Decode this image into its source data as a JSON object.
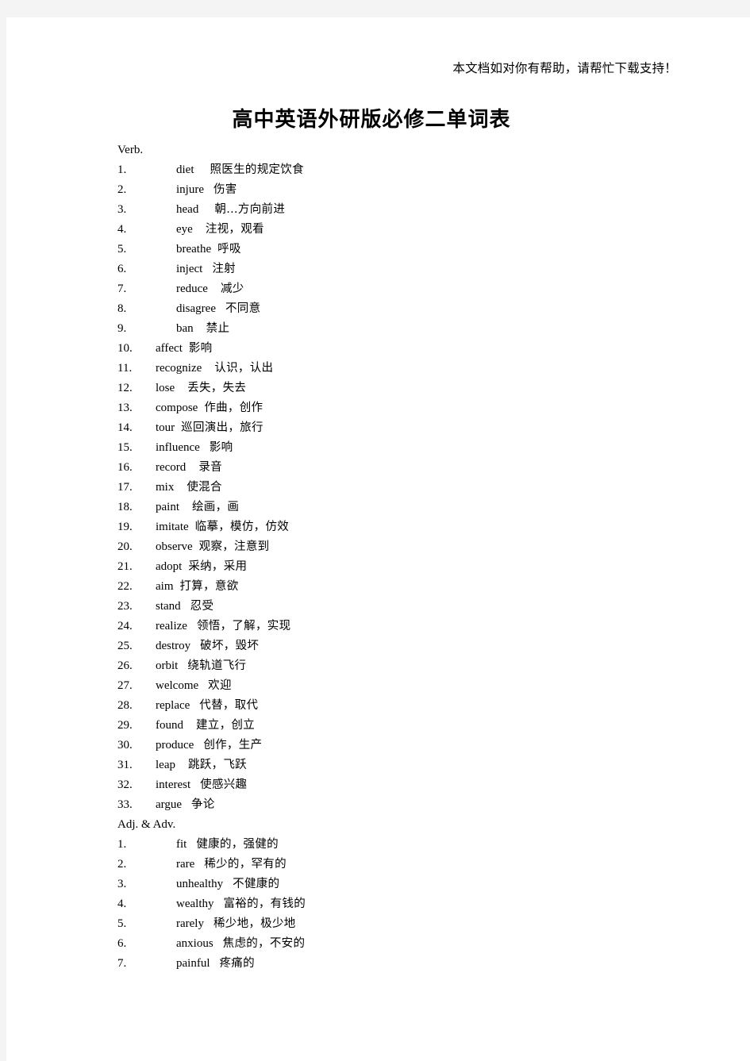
{
  "document": {
    "header_note": "本文档如对你有帮助，请帮忙下载支持！",
    "title": "高中英语外研版必修二单词表"
  },
  "sections": [
    {
      "heading": "Verb.",
      "entries": [
        {
          "num": "1.",
          "word": "diet",
          "meaning": "照医生的规定饮食",
          "gap": 4
        },
        {
          "num": "2.",
          "word": "injure",
          "meaning": "伤害",
          "gap": 2
        },
        {
          "num": "3.",
          "word": "head",
          "meaning": "朝…方向前进",
          "gap": 4
        },
        {
          "num": "4.",
          "word": "eye",
          "meaning": "注视，观看",
          "gap": 3
        },
        {
          "num": "5.",
          "word": "breathe",
          "meaning": "呼吸",
          "gap": 1
        },
        {
          "num": "6.",
          "word": "inject",
          "meaning": "注射",
          "gap": 2
        },
        {
          "num": "7.",
          "word": "reduce",
          "meaning": "减少",
          "gap": 3
        },
        {
          "num": "8.",
          "word": "disagree",
          "meaning": "不同意",
          "gap": 2
        },
        {
          "num": "9.",
          "word": "ban",
          "meaning": "禁止",
          "gap": 3
        },
        {
          "num": "10.",
          "word": "affect",
          "meaning": "影响",
          "gap": 1
        },
        {
          "num": "11.",
          "word": "recognize",
          "meaning": "认识，认出",
          "gap": 3
        },
        {
          "num": "12.",
          "word": "lose",
          "meaning": "丢失，失去",
          "gap": 3
        },
        {
          "num": "13.",
          "word": "compose",
          "meaning": "作曲，创作",
          "gap": 1
        },
        {
          "num": "14.",
          "word": "tour",
          "meaning": "巡回演出，旅行",
          "gap": 1
        },
        {
          "num": "15.",
          "word": "influence",
          "meaning": "影响",
          "gap": 2
        },
        {
          "num": "16.",
          "word": "record",
          "meaning": "录音",
          "gap": 3
        },
        {
          "num": "17.",
          "word": "mix",
          "meaning": "使混合",
          "gap": 3
        },
        {
          "num": "18.",
          "word": "paint",
          "meaning": "绘画，画",
          "gap": 3
        },
        {
          "num": "19.",
          "word": "imitate",
          "meaning": "临摹，模仿，仿效",
          "gap": 1
        },
        {
          "num": "20.",
          "word": "observe",
          "meaning": "观察，注意到",
          "gap": 1
        },
        {
          "num": "21.",
          "word": "adopt",
          "meaning": "采纳，采用",
          "gap": 1
        },
        {
          "num": "22.",
          "word": "aim",
          "meaning": "打算，意欲",
          "gap": 1
        },
        {
          "num": "23.",
          "word": "stand",
          "meaning": "忍受",
          "gap": 2
        },
        {
          "num": "24.",
          "word": "realize",
          "meaning": "领悟，了解，实现",
          "gap": 2
        },
        {
          "num": "25.",
          "word": "destroy",
          "meaning": "破坏，毁坏",
          "gap": 2
        },
        {
          "num": "26.",
          "word": "orbit",
          "meaning": "绕轨道飞行",
          "gap": 2
        },
        {
          "num": "27.",
          "word": "welcome",
          "meaning": "欢迎",
          "gap": 2
        },
        {
          "num": "28.",
          "word": "replace",
          "meaning": "代替，取代",
          "gap": 2
        },
        {
          "num": "29.",
          "word": "found",
          "meaning": "建立，创立",
          "gap": 3
        },
        {
          "num": "30.",
          "word": "produce",
          "meaning": "创作，生产",
          "gap": 2
        },
        {
          "num": "31.",
          "word": "leap",
          "meaning": "跳跃，飞跃",
          "gap": 3
        },
        {
          "num": "32.",
          "word": "interest",
          "meaning": "使感兴趣",
          "gap": 2
        },
        {
          "num": "33.",
          "word": "argue",
          "meaning": "争论",
          "gap": 2
        }
      ]
    },
    {
      "heading": "Adj. & Adv.",
      "entries": [
        {
          "num": "1.",
          "word": "fit",
          "meaning": "健康的，强健的",
          "gap": 2
        },
        {
          "num": "2.",
          "word": "rare",
          "meaning": "稀少的，罕有的",
          "gap": 2
        },
        {
          "num": "3.",
          "word": "unhealthy",
          "meaning": "不健康的",
          "gap": 2
        },
        {
          "num": "4.",
          "word": "wealthy",
          "meaning": "富裕的，有钱的",
          "gap": 2
        },
        {
          "num": "5.",
          "word": "rarely",
          "meaning": "稀少地，极少地",
          "gap": 2
        },
        {
          "num": "6.",
          "word": "anxious",
          "meaning": "焦虑的，不安的",
          "gap": 2
        },
        {
          "num": "7.",
          "word": "painful",
          "meaning": "疼痛的",
          "gap": 2
        }
      ]
    }
  ]
}
